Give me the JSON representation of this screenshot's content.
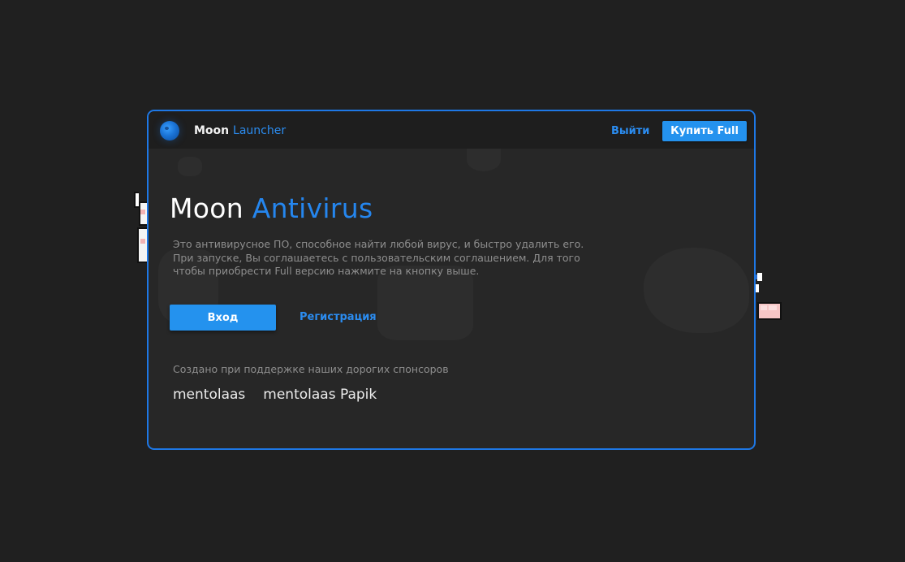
{
  "header": {
    "logo_icon": "moon-icon",
    "app_name": "Moon",
    "app_name_accent": "Launcher",
    "logout_label": "Выйти",
    "buy_label": "Купить Full"
  },
  "hero": {
    "title": "Moon",
    "title_accent": "Antivirus",
    "description_lines": [
      "Это антивирусное ПО, способное найти любой вирус, и быстро удалить его.",
      "При запуске, Вы соглашаетесь с пользовательским соглашением. Для того",
      "чтобы приобрести Full версию нажмите на кнопку выше."
    ]
  },
  "actions": {
    "login_label": "Вход",
    "register_label": "Регистрация"
  },
  "sponsors": {
    "caption": "Создано при поддержке наших дорогих спонсоров",
    "names": [
      "mentolaas",
      "mentolaas Papik"
    ]
  },
  "colors": {
    "accent": "#2492ee",
    "border": "#1e78e6",
    "background": "#202020",
    "window": "#272727"
  }
}
